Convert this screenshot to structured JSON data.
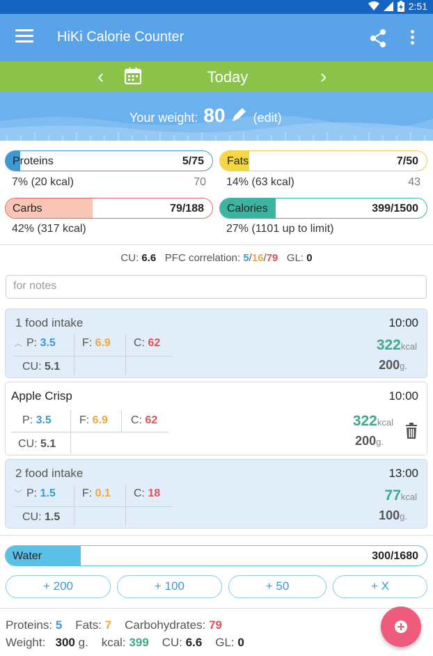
{
  "status": {
    "time": "2:51"
  },
  "appbar": {
    "title": "HiKi Calorie Counter"
  },
  "date": {
    "label": "Today"
  },
  "weight": {
    "label": "Your weight:",
    "value": "80",
    "edit": "(edit)"
  },
  "macros": {
    "proteins": {
      "name": "Proteins",
      "value": "5/75",
      "pct": "7%",
      "kcal": "(20 kcal)",
      "remaining": "70",
      "fill_fraction": 0.07,
      "color": "#3d98d3"
    },
    "fats": {
      "name": "Fats",
      "value": "7/50",
      "pct": "14%",
      "kcal": "(63 kcal)",
      "remaining": "43",
      "fill_fraction": 0.14,
      "color": "#f5d742"
    },
    "carbs": {
      "name": "Carbs",
      "value": "79/188",
      "pct": "42%",
      "kcal": "(317 kcal)",
      "fill_fraction": 0.42,
      "color": "#f8c5b4"
    },
    "calories": {
      "name": "Calories",
      "value": "399/1500",
      "pct": "27%",
      "kcal": "(1101 up to limit)",
      "fill_fraction": 0.27,
      "color": "#3db4a0"
    }
  },
  "cu_line": {
    "cu_label": "CU:",
    "cu_value": "6.6",
    "pfc_label": "PFC correlation:",
    "p": "5",
    "f": "16",
    "c": "79",
    "sep": "/",
    "gl_label": "GL:",
    "gl_value": "0"
  },
  "notes": {
    "placeholder": "for notes"
  },
  "entries": [
    {
      "name": "1 food intake",
      "time": "10:00",
      "p_label": "P:",
      "p": "3.5",
      "f_label": "F:",
      "f": "6.9",
      "c_label": "C:",
      "c": "62",
      "cu_label": "CU:",
      "cu": "5.1",
      "kcal": "322",
      "kcal_unit": "kcal",
      "grams": "200",
      "grams_unit": "g."
    },
    {
      "name": "Apple Crisp",
      "time": "10:00",
      "p_label": "P:",
      "p": "3.5",
      "f_label": "F:",
      "f": "6.9",
      "c_label": "C:",
      "c": "62",
      "cu_label": "CU:",
      "cu": "5.1",
      "kcal": "322",
      "kcal_unit": "kcal",
      "grams": "200",
      "grams_unit": "g."
    },
    {
      "name": "2 food intake",
      "time": "13:00",
      "p_label": "P:",
      "p": "1.5",
      "f_label": "F:",
      "f": "0.1",
      "c_label": "C:",
      "c": "18",
      "cu_label": "CU:",
      "cu": "1.5",
      "kcal": "77",
      "kcal_unit": "kcal",
      "grams": "100",
      "grams_unit": "g."
    }
  ],
  "water": {
    "name": "Water",
    "value": "300/1680",
    "fill_fraction": 0.179,
    "color": "#5bc0e6",
    "buttons": [
      "+ 200",
      "+ 100",
      "+ 50",
      "+ X"
    ]
  },
  "summary": {
    "proteins_label": "Proteins:",
    "proteins": "5",
    "fats_label": "Fats:",
    "fats": "7",
    "carbs_label": "Carbohydrates:",
    "carbs": "79",
    "weight_label": "Weight:",
    "weight": "300",
    "weight_unit": "g.",
    "kcal_label": "kcal:",
    "kcal": "399",
    "cu_label": "CU:",
    "cu": "6.6",
    "gl_label": "GL:",
    "gl": "0"
  }
}
